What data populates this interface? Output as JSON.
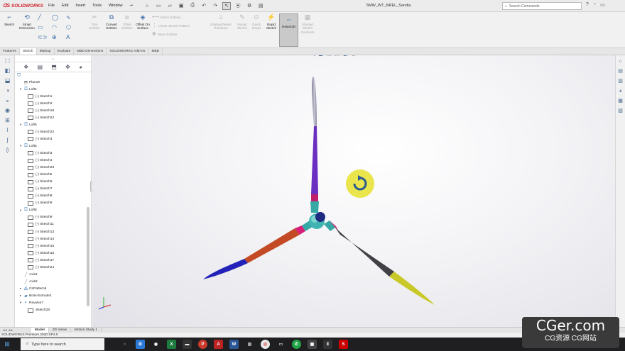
{
  "app": {
    "brand": "SOLIDWORKS",
    "menus": [
      "File",
      "Edit",
      "Insert",
      "Tools",
      "Window"
    ],
    "document_title": "5MW_WT_NREL_Sandia",
    "search_placeholder": "Search Commands",
    "status": "SOLIDWORKS Premium 2020 SP4.0"
  },
  "commands": {
    "sketch": "Sketch",
    "smart_dimension": "Smart Dimension",
    "trim_entities": "Trim Entities",
    "convert_entities": "Convert Entities",
    "offset_entities": "Offset Entities",
    "offset_on_surface": "Offset On Surface",
    "mirror_entities": "Mirror Entities",
    "linear_pattern": "Linear Sketch Pattern",
    "move_entities": "Move Entities",
    "display_relations": "Display/Delete Relations",
    "repair_sketch": "Repair Sketch",
    "quick_snaps": "Quick Snaps",
    "rapid_sketch": "Rapid Sketch",
    "instant2d": "Instant2D",
    "shaded_contours": "Shaded Sketch Contours"
  },
  "tabs": [
    "Features",
    "Sketch",
    "Markup",
    "Evaluate",
    "MBD Dimensions",
    "SOLIDWORKS Add-Ins",
    "MBD"
  ],
  "active_tab": "Sketch",
  "tree": [
    {
      "label": "Plan19",
      "level": 1,
      "kind": "plane"
    },
    {
      "label": "Loft4",
      "level": 1,
      "kind": "loft"
    },
    {
      "label": "(-) Sketch1",
      "level": 2,
      "kind": "sketch"
    },
    {
      "label": "(-) Sketch2",
      "level": 2,
      "kind": "sketch"
    },
    {
      "label": "(-) Sketch19",
      "level": 2,
      "kind": "sketch"
    },
    {
      "label": "(-) Sketch22",
      "level": 2,
      "kind": "sketch"
    },
    {
      "label": "Loft5",
      "level": 1,
      "kind": "loft"
    },
    {
      "label": "(-) Sketch22",
      "level": 2,
      "kind": "sketch"
    },
    {
      "label": "(-) Sketch3",
      "level": 2,
      "kind": "sketch"
    },
    {
      "label": "Loft6",
      "level": 1,
      "kind": "loft"
    },
    {
      "label": "(-) Sketch3",
      "level": 2,
      "kind": "sketch"
    },
    {
      "label": "(-) Sketch4",
      "level": 2,
      "kind": "sketch"
    },
    {
      "label": "(-) Sketch23",
      "level": 2,
      "kind": "sketch"
    },
    {
      "label": "(-) Sketch5",
      "level": 2,
      "kind": "sketch"
    },
    {
      "label": "(-) Sketch6",
      "level": 2,
      "kind": "sketch"
    },
    {
      "label": "(-) Sketch7",
      "level": 2,
      "kind": "sketch"
    },
    {
      "label": "(-) Sketch8",
      "level": 2,
      "kind": "sketch"
    },
    {
      "label": "(-) Sketch9",
      "level": 2,
      "kind": "sketch"
    },
    {
      "label": "Loft8",
      "level": 1,
      "kind": "loft"
    },
    {
      "label": "(-) Sketch9",
      "level": 2,
      "kind": "sketch"
    },
    {
      "label": "(-) Sketch11",
      "level": 2,
      "kind": "sketch"
    },
    {
      "label": "(-) Sketch13",
      "level": 2,
      "kind": "sketch"
    },
    {
      "label": "(-) Sketch14",
      "level": 2,
      "kind": "sketch"
    },
    {
      "label": "(-) Sketch15",
      "level": 2,
      "kind": "sketch"
    },
    {
      "label": "(-) Sketch16",
      "level": 2,
      "kind": "sketch"
    },
    {
      "label": "(-) Sketch17",
      "level": 2,
      "kind": "sketch"
    },
    {
      "label": "(-) Sketch24",
      "level": 2,
      "kind": "sketch"
    },
    {
      "label": "Axis1",
      "level": 1,
      "kind": "axis"
    },
    {
      "label": "Axis2",
      "level": 1,
      "kind": "axis"
    },
    {
      "label": "CirPattern6",
      "level": 1,
      "kind": "pattern"
    },
    {
      "label": "Boss-Extrude2",
      "level": 1,
      "kind": "extrude"
    },
    {
      "label": "Revolve7",
      "level": 1,
      "kind": "revolve"
    },
    {
      "label": "Sketch28",
      "level": 2,
      "kind": "sketch"
    }
  ],
  "bottom_tabs": [
    "Model",
    "3D Views",
    "Motion Study 1"
  ],
  "active_bottom_tab": "Model",
  "taskbar": {
    "search_placeholder": "Type here to search"
  },
  "watermark": {
    "main": "CGer.com",
    "sub": "CG资源 CG网站"
  },
  "colors": {
    "blade1": [
      "#9e9eb4",
      "#6a2fc0",
      "#c0206a"
    ],
    "blade2": [
      "#d8207a",
      "#c44a26",
      "#2222b8"
    ],
    "blade3": [
      "#c0307a",
      "#404045",
      "#c8c828"
    ],
    "hub": "#36a8a6",
    "rotate_cursor": "#e8e23a"
  }
}
